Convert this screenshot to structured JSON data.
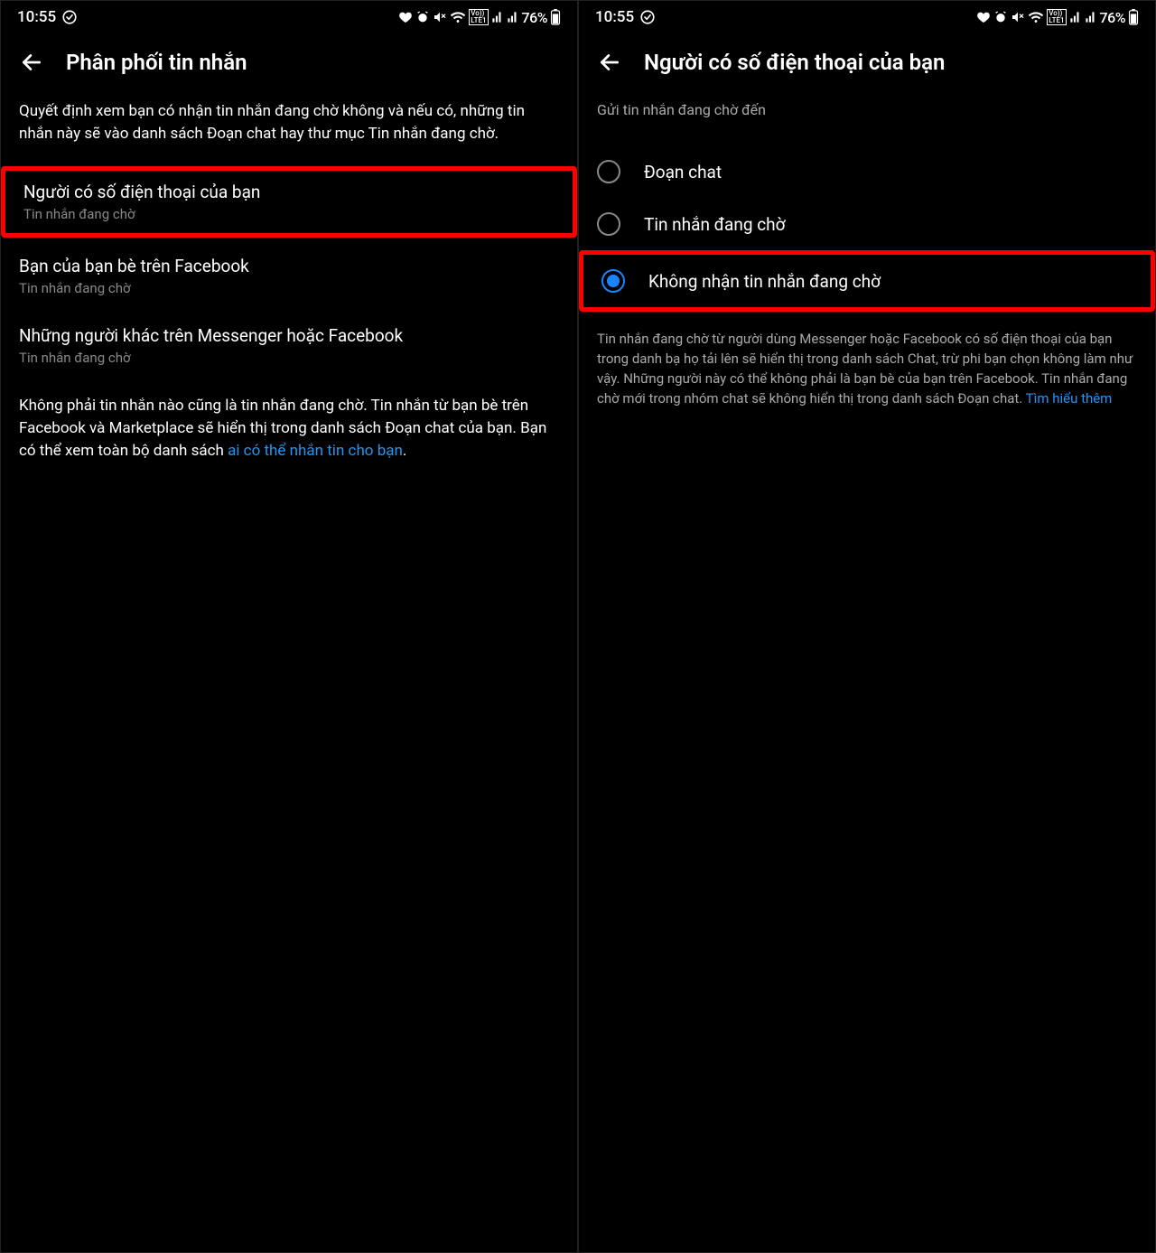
{
  "status": {
    "time": "10:55",
    "battery_percent": "76%"
  },
  "screen1": {
    "title": "Phân phối tin nhắn",
    "description": "Quyết định xem bạn có nhận tin nhắn đang chờ không và nếu có, những tin nhắn này sẽ vào danh sách Đoạn chat hay thư mục Tin nhắn đang chờ.",
    "items": [
      {
        "title": "Người có số điện thoại của bạn",
        "sub": "Tin nhắn đang chờ",
        "highlighted": true
      },
      {
        "title": "Bạn của bạn bè trên Facebook",
        "sub": "Tin nhắn đang chờ",
        "highlighted": false
      },
      {
        "title": "Những người khác trên Messenger hoặc Facebook",
        "sub": "Tin nhắn đang chờ",
        "highlighted": false
      }
    ],
    "footer_prefix": "Không phải tin nhắn nào cũng là tin nhắn đang chờ. Tin nhắn từ bạn bè trên Facebook và Marketplace sẽ hiển thị trong danh sách Đoạn chat của bạn. Bạn có thể xem toàn bộ danh sách ",
    "footer_link": "ai có thể nhắn tin cho bạn",
    "footer_period": "."
  },
  "screen2": {
    "title": "Người có số điện thoại của bạn",
    "subheader": "Gửi tin nhắn đang chờ đến",
    "options": [
      {
        "label": "Đoạn chat",
        "selected": false,
        "highlighted": false
      },
      {
        "label": "Tin nhắn đang chờ",
        "selected": false,
        "highlighted": false
      },
      {
        "label": "Không nhận tin nhắn đang chờ",
        "selected": true,
        "highlighted": true
      }
    ],
    "footer_prefix": "Tin nhắn đang chờ từ người dùng Messenger hoặc Facebook có số điện thoại của bạn trong danh bạ họ tải lên sẽ hiển thị trong danh sách Chat, trừ phi bạn chọn không làm như vậy. Những người này có thể không phải là bạn bè của bạn trên Facebook. Tin nhắn đang chờ mới trong nhóm chat sẽ không hiển thị trong danh sách Đoạn chat. ",
    "footer_link": "Tìm hiểu thêm"
  }
}
